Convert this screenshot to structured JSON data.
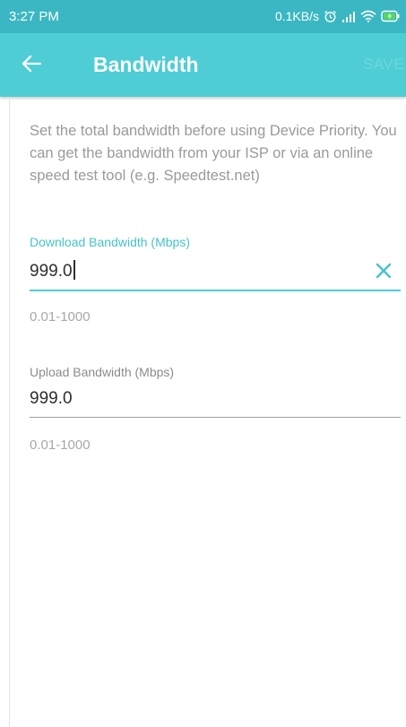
{
  "status_bar": {
    "time": "3:27 PM",
    "network_speed": "0.1KB/s",
    "icons": [
      "alarm-icon",
      "signal-icon",
      "wifi-icon",
      "battery-charging-icon"
    ]
  },
  "app_bar": {
    "title": "Bandwidth",
    "back_icon": "arrow-left-icon",
    "save_label": "SAVE"
  },
  "description": "Set the total bandwidth before using Device Priority. You can get the bandwidth from your ISP or via an online speed test tool (e.g. Speedtest.net)",
  "download": {
    "label": "Download Bandwidth (Mbps)",
    "value": "999.0",
    "helper": "0.01-1000",
    "focused": true,
    "clear_icon": "close-icon"
  },
  "upload": {
    "label": "Upload Bandwidth (Mbps)",
    "value": "999.0",
    "helper": "0.01-1000",
    "focused": false
  },
  "colors": {
    "status_bar": "#3ab7c3",
    "app_bar": "#4ecdd5",
    "accent": "#45c3cc",
    "helper_text": "#a8a8a8"
  }
}
